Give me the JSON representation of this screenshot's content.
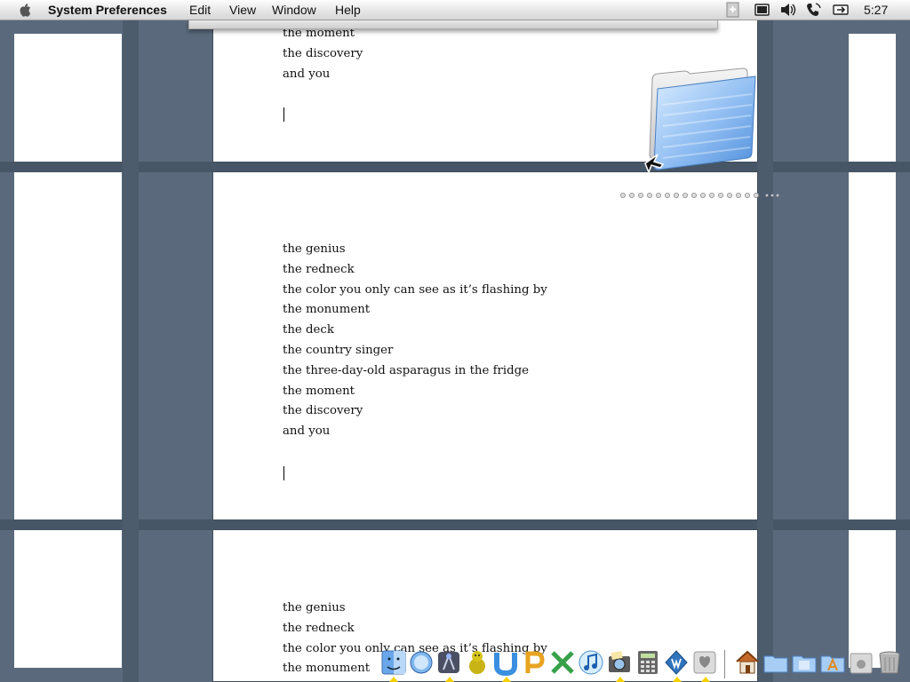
{
  "menubar": {
    "app_name": "System Preferences",
    "menus": [
      "Edit",
      "View",
      "Window",
      "Help"
    ],
    "clock": "5:27",
    "extras": [
      "script-menu-icon",
      "battery-icon",
      "volume-icon",
      "phone-icon",
      "power-icon"
    ]
  },
  "document": {
    "top_page_lines": [
      "the moment",
      "the discovery",
      "and you"
    ],
    "middle_page_lines": [
      "the genius",
      "the redneck",
      "the color you only can see as it’s flashing by",
      "the monument",
      "the deck",
      "the country singer",
      "the three-day-old asparagus in the fridge",
      "the moment",
      "the discovery",
      "and you"
    ],
    "bottom_page_lines": [
      "the genius",
      "the redneck",
      "the color you only can see as it’s flashing by",
      "the monument"
    ]
  },
  "drag": {
    "icon": "folder-icon"
  },
  "dock": {
    "apps": [
      "finder",
      "safari",
      "dashboard",
      "ichat",
      "app-u",
      "app-p",
      "app-x",
      "itunes",
      "iphoto",
      "calculator",
      "app-w",
      "system-preferences"
    ],
    "folders": [
      "home",
      "folder",
      "documents",
      "applications",
      "apple-folder",
      "trash"
    ]
  },
  "colors": {
    "desk": "#5a6a7c",
    "page": "#ffffff",
    "menubar": "#e4e4e4",
    "folder": "#8ab8ef",
    "dock_arrow": "#f6d100"
  }
}
